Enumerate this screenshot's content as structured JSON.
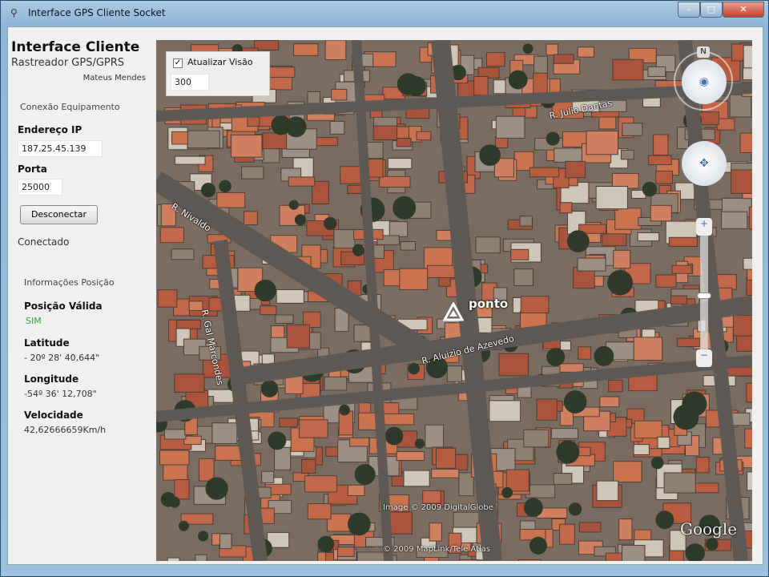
{
  "window": {
    "title": "Interface GPS Cliente Socket",
    "minimize": "–",
    "maximize": "□",
    "close": "✕"
  },
  "header": {
    "title": "Interface Cliente",
    "subtitle": "Rastreador GPS/GPRS",
    "author": "Mateus Mendes"
  },
  "connection": {
    "group_label": "Conexão Equipamento",
    "ip_label": "Endereço IP",
    "ip_value": "187.25.45.139",
    "port_label": "Porta",
    "port_value": "25000",
    "button_label": "Desconectar",
    "status": "Conectado"
  },
  "position": {
    "group_label": "Informações Posição",
    "valid_label": "Posição Válida",
    "valid_value": "SIM",
    "valid_color": "#3aa34a",
    "lat_label": "Latitude",
    "lat_value": "- 20º 28' 40,644\"",
    "lon_label": "Longitude",
    "lon_value": "-54º 36' 12,708\"",
    "speed_label": "Velocidade",
    "speed_value": "42,62666659Km/h"
  },
  "map": {
    "update_label": "Atualizar Visão",
    "update_checked": true,
    "update_interval": "300",
    "marker_label": "ponto",
    "streets": [
      "R. Julio Dantas",
      "R. Nivaldo",
      "R. Aluizio de Azevedo",
      "R. Gal Marcondes"
    ],
    "copyright_image": "Image © 2009 DigitalGlobe",
    "copyright_map": "© 2009 MapLink/Tele Atlas",
    "logo": "Google",
    "north": "N",
    "zoom_level": 0.5
  }
}
